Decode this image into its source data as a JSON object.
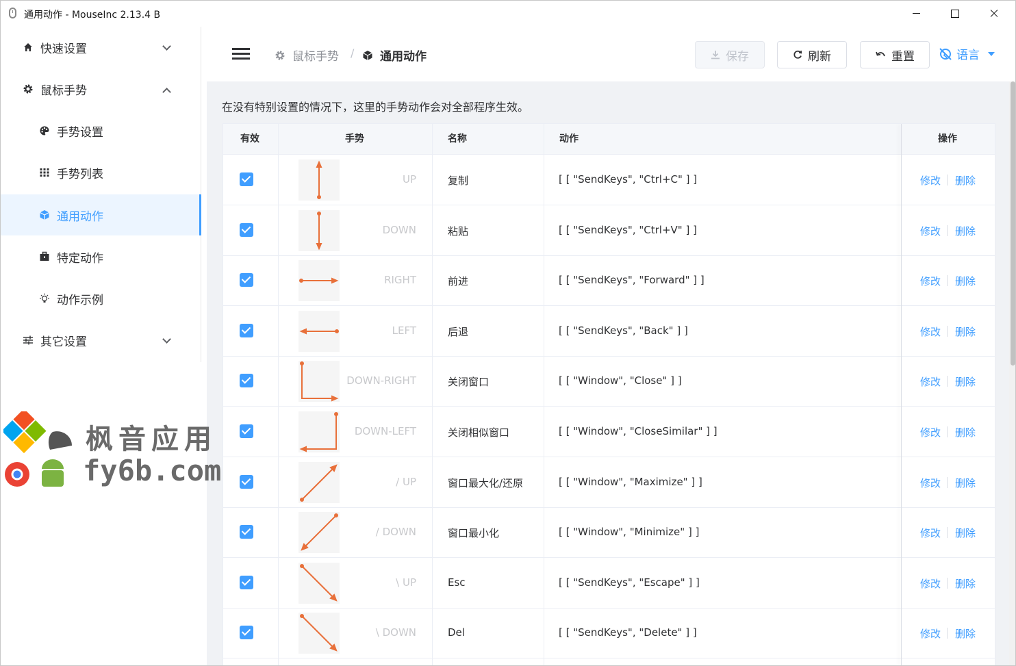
{
  "window": {
    "title": "通用动作 - MouseInc 2.13.4 B"
  },
  "sidebar": {
    "items": [
      {
        "label": "快速设置",
        "icon": "home-icon"
      },
      {
        "label": "鼠标手势",
        "icon": "gear-icon"
      },
      {
        "label": "手势设置",
        "icon": "palette-icon"
      },
      {
        "label": "手势列表",
        "icon": "grid-icon"
      },
      {
        "label": "通用动作",
        "icon": "cube-icon"
      },
      {
        "label": "特定动作",
        "icon": "briefcase-icon"
      },
      {
        "label": "动作示例",
        "icon": "bulb-icon"
      },
      {
        "label": "其它设置",
        "icon": "sliders-icon"
      }
    ]
  },
  "header": {
    "breadcrumb": [
      "鼠标手势",
      "通用动作"
    ],
    "breadcrumb_sep": "/",
    "save_label": "保存",
    "refresh_label": "刷新",
    "reset_label": "重置",
    "language_label": "语言"
  },
  "main": {
    "notice": "在没有特别设置的情况下，这里的手势动作会对全部程序生效。",
    "columns": [
      "有效",
      "手势",
      "名称",
      "动作",
      "操作"
    ],
    "edit_label": "修改",
    "delete_label": "删除",
    "rows": [
      {
        "enabled": true,
        "gesture": "UP",
        "shape": "up",
        "name": "复制",
        "action": "[ [ \"SendKeys\", \"Ctrl+C\" ] ]"
      },
      {
        "enabled": true,
        "gesture": "DOWN",
        "shape": "down",
        "name": "粘贴",
        "action": "[ [ \"SendKeys\", \"Ctrl+V\" ] ]"
      },
      {
        "enabled": true,
        "gesture": "RIGHT",
        "shape": "right",
        "name": "前进",
        "action": "[ [ \"SendKeys\", \"Forward\" ] ]"
      },
      {
        "enabled": true,
        "gesture": "LEFT",
        "shape": "left",
        "name": "后退",
        "action": "[ [ \"SendKeys\", \"Back\" ] ]"
      },
      {
        "enabled": true,
        "gesture": "DOWN-RIGHT",
        "shape": "down-right",
        "name": "关闭窗口",
        "action": "[ [ \"Window\", \"Close\" ] ]"
      },
      {
        "enabled": true,
        "gesture": "DOWN-LEFT",
        "shape": "down-left",
        "name": "关闭相似窗口",
        "action": "[ [ \"Window\", \"CloseSimilar\" ] ]"
      },
      {
        "enabled": true,
        "gesture": "/ UP",
        "shape": "slash-up",
        "name": "窗口最大化/还原",
        "action": "[ [ \"Window\", \"Maximize\" ] ]"
      },
      {
        "enabled": true,
        "gesture": "/ DOWN",
        "shape": "slash-down",
        "name": "窗口最小化",
        "action": "[ [ \"Window\", \"Minimize\" ] ]"
      },
      {
        "enabled": true,
        "gesture": "\\ UP",
        "shape": "backslash-up",
        "name": "Esc",
        "action": "[ [ \"SendKeys\", \"Escape\" ] ]"
      },
      {
        "enabled": true,
        "gesture": "\\ DOWN",
        "shape": "backslash-down",
        "name": "Del",
        "action": "[ [ \"SendKeys\", \"Delete\" ] ]"
      }
    ]
  },
  "watermark": {
    "line1": "枫音应用",
    "line2": "fy6b.com"
  },
  "colors": {
    "accent": "#409eff",
    "gesture_stroke": "#e8703a"
  }
}
